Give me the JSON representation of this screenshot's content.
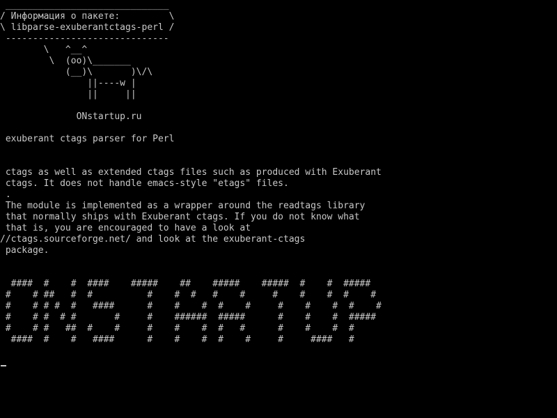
{
  "terminal": {
    "lines": [
      " ______________________________",
      "/ Информация о пакете:         \\",
      "\\ libparse-exuberantctags-perl /",
      " ------------------------------",
      "        \\   ^__^",
      "         \\  (oo)\\_______",
      "            (__)\\       )\\/\\",
      "                ||----w |",
      "                ||     ||",
      "",
      "              ONstartup.ru",
      "",
      " exuberant ctags parser for Perl",
      "",
      "",
      " ctags as well as extended ctags files such as produced with Exuberant",
      " ctags. It does not handle emacs-style \"etags\" files.",
      " .",
      " The module is implemented as a wrapper around the readtags library",
      " that normally ships with Exuberant ctags. If you do not know what",
      " that is, you are encouraged to have a look at",
      "//ctags.sourceforge.net/ and look at the exuberant-ctags",
      " package.",
      "",
      "",
      "  ####  #    #  ####    #####    ##    #####    #####  #    #  #####",
      " #    # ##   #  #          #    #  #   #    #     #    #    #  #    #",
      " #    # # #  #   ####      #    #    #  #    #     #    #    #  #    #",
      " #    # #  # #       #     #    ######  #####      #    #    #  #####",
      " #    # #   ##  #    #     #    #    #  #   #      #    #    #  #",
      "  ####  #    #   ####      #    #    #  #    #     #     ####   #"
    ],
    "text_color": "#c8c8c8",
    "background_color": "#000000"
  }
}
